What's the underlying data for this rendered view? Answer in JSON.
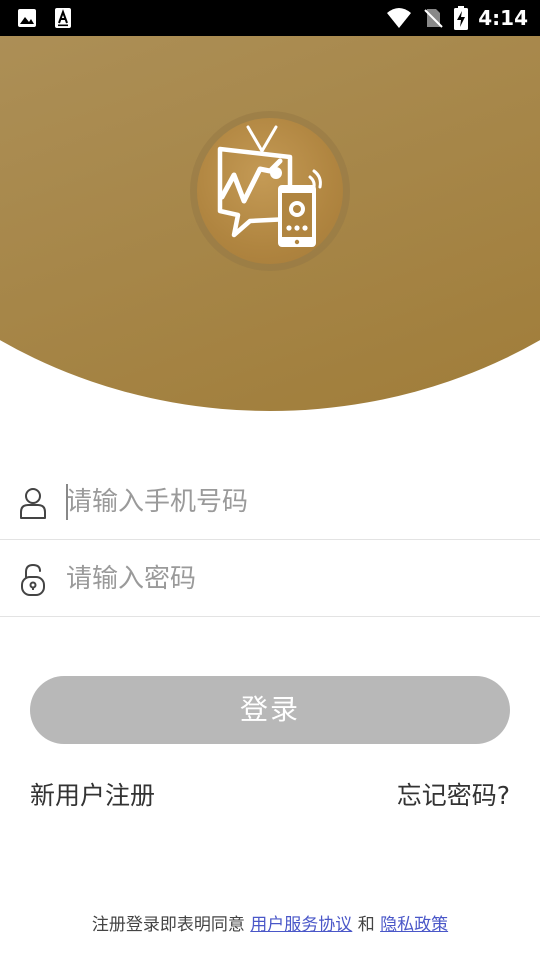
{
  "status_bar": {
    "time": "4:14",
    "left_icons": [
      "image-icon",
      "text-a-icon"
    ],
    "right_icons": [
      "wifi-icon",
      "no-sim-icon",
      "battery-charging-icon"
    ]
  },
  "header": {
    "logo": "tv-phone-remote-logo",
    "colors": {
      "gradient_start": "#b9a172",
      "gradient_end": "#9e7a35"
    }
  },
  "form": {
    "phone": {
      "placeholder": "请输入手机号码",
      "value": "",
      "icon": "user-icon"
    },
    "password": {
      "placeholder": "请输入密码",
      "value": "",
      "icon": "unlock-icon"
    },
    "login_label": "登录"
  },
  "links": {
    "register": "新用户注册",
    "forgot": "忘记密码?"
  },
  "agreement": {
    "prefix": "注册登录即表明同意",
    "terms": "用户服务协议",
    "and": "和",
    "privacy": "隐私政策"
  },
  "colors": {
    "button_disabled": "#b8b8b8",
    "link": "#4a57c8"
  }
}
